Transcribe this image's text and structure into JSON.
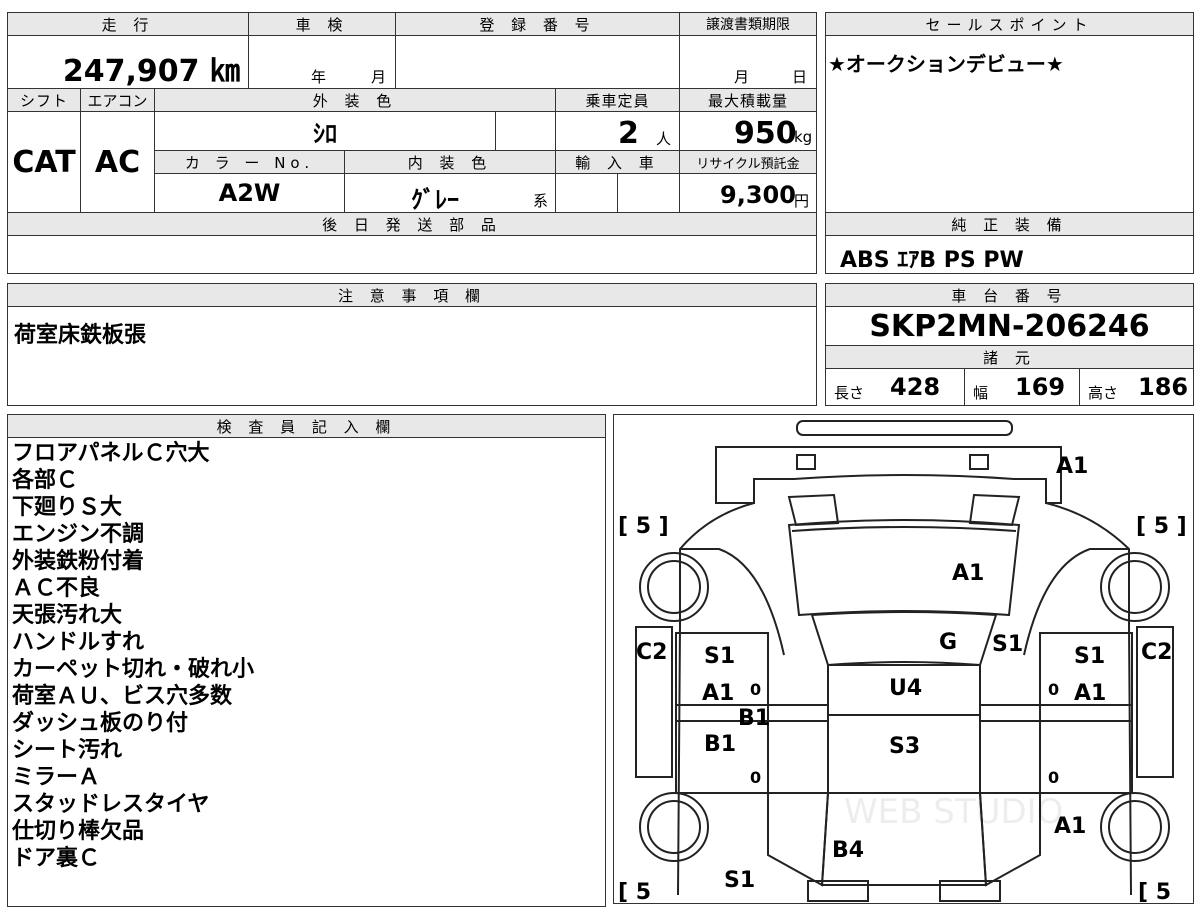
{
  "top_table": {
    "mileage_label": "走 行",
    "mileage_value": "247,907 ㎞",
    "inspection_label": "車 検",
    "inspection_year_unit": "年",
    "inspection_month_unit": "月",
    "registration_label": "登 録 番 号",
    "transfer_deadline_label": "譲渡書類期限",
    "transfer_month_unit": "月",
    "transfer_day_unit": "日",
    "shift_label": "シフト",
    "aircon_label": "エアコン",
    "exterior_color_label": "外 装 色",
    "capacity_label": "乗車定員",
    "max_load_label": "最大積載量",
    "shift_value": "CAT",
    "aircon_value": "AC",
    "exterior_color_value": "ｼﾛ",
    "capacity_value": "2",
    "capacity_unit": "人",
    "max_load_value": "950",
    "max_load_unit": "kg",
    "color_no_label": "カ ラ ー No.",
    "interior_color_label": "内 装 色",
    "import_label": "輸 入 車",
    "recycle_label": "リサイクル預託金",
    "color_no_value": "A2W",
    "interior_color_value": "ｸﾞﾚｰ",
    "interior_color_suffix": "系",
    "recycle_value": "9,300",
    "recycle_unit": "円",
    "later_parts_label": "後 日 発 送 部 品"
  },
  "sales_point": {
    "label": "セールスポイント",
    "value": "★オークションデビュー★"
  },
  "genuine_equipment": {
    "label": "純 正 装 備",
    "value": "ABS ｴｱB PS PW"
  },
  "notes": {
    "label": "注 意 事 項 欄",
    "value": "荷室床鉄板張"
  },
  "chassis": {
    "label": "車 台 番 号",
    "value": "SKP2MN-206246",
    "specs_label": "諸 元",
    "length_label": "長さ",
    "length_value": "428",
    "width_label": "幅",
    "width_value": "169",
    "height_label": "高さ",
    "height_value": "186"
  },
  "inspector": {
    "label": "検 査 員 記 入 欄",
    "lines": [
      "フロアパネルＣ穴大",
      "各部Ｃ",
      "下廻りＳ大",
      "エンジン不調",
      "外装鉄粉付着",
      "ＡＣ不良",
      "天張汚れ大",
      "ハンドルすれ",
      "カーペット切れ・破れ小",
      "荷室ＡＵ、ビス穴多数",
      "ダッシュ板のり付",
      "シート汚れ",
      "ミラーＡ",
      "スタッドレスタイヤ",
      "仕切り棒欠品",
      "ドア裏Ｃ"
    ]
  },
  "diagram": {
    "marks": {
      "front_bumper": "A1",
      "hood": "A1",
      "windshield": "G",
      "windshield_right": "S1",
      "roof": "U4",
      "roof_mid": "S3",
      "rear": "B4",
      "left_fender": "C2",
      "right_fender": "C2",
      "left_front_door": "S1",
      "left_front_door_2": "A1",
      "left_mid": "B1",
      "left_rear_door": "B1",
      "right_front_door": "S1",
      "right_front_door_2": "A1",
      "right_rear": "A1",
      "left_rear_bottom": "S1",
      "tire_fl": "[ 5 ]",
      "tire_fr": "[ 5 ]",
      "tire_rl": "[ 5",
      "tire_rr": "[ 5"
    },
    "zero_marks": [
      "0",
      "0",
      "0",
      "0"
    ],
    "watermark": "WEB STUDIO"
  }
}
